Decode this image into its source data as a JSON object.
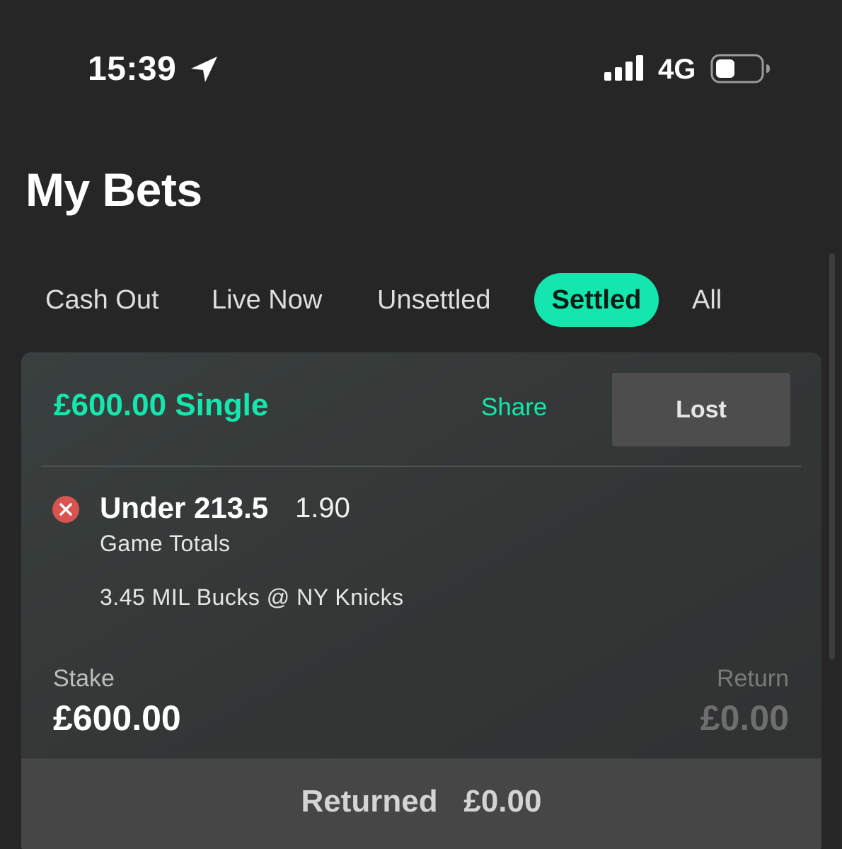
{
  "status_bar": {
    "time": "15:39",
    "network": "4G",
    "battery_level": 0.3,
    "icons": [
      "location-arrow-icon",
      "signal-bars-icon",
      "battery-icon"
    ]
  },
  "page": {
    "title": "My Bets"
  },
  "tabs": [
    {
      "label": "Cash Out",
      "active": false
    },
    {
      "label": "Live Now",
      "active": false
    },
    {
      "label": "Unsettled",
      "active": false
    },
    {
      "label": "Settled",
      "active": true
    },
    {
      "label": "All",
      "active": false
    }
  ],
  "bet": {
    "title": "£600.00 Single",
    "share_label": "Share",
    "status": "Lost",
    "selection": {
      "name": "Under 213.5",
      "odds": "1.90",
      "market": "Game Totals",
      "event": "3.45 MIL Bucks @ NY Knicks",
      "result_icon": "lost-x-icon"
    },
    "stake_label": "Stake",
    "stake_value": "£600.00",
    "return_label": "Return",
    "return_value": "£0.00",
    "returned_label": "Returned",
    "returned_value": "£0.00"
  },
  "colors": {
    "background": "#262626",
    "accent": "#14e6ad",
    "card": "#353a39",
    "lost_red": "#d9534f",
    "badge": "#4d4d4d"
  }
}
